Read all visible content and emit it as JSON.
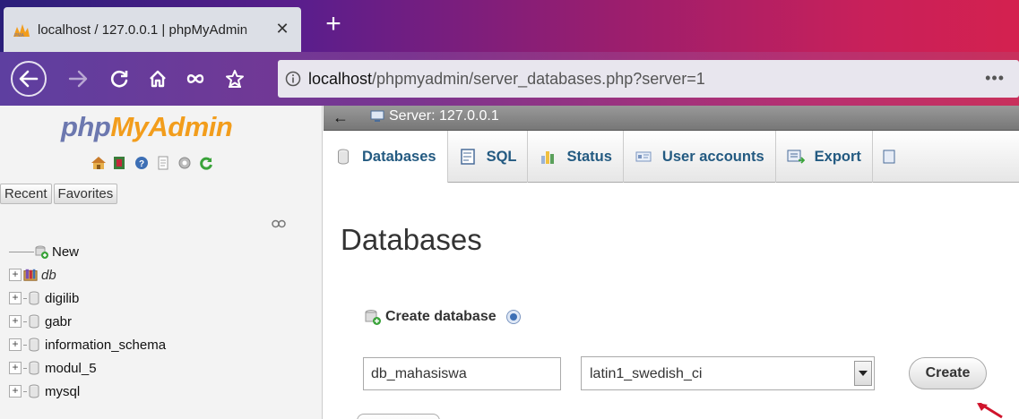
{
  "browser": {
    "tab_title": "localhost / 127.0.0.1 | phpMyAdmin",
    "tab_close": "✕",
    "new_tab": "+",
    "url_host": "localhost",
    "url_path": "/phpmyadmin/server_databases.php?server=1",
    "more": "•••"
  },
  "sidebar": {
    "logo_php": "php",
    "logo_myadmin": "MyAdmin",
    "recent_label": "Recent",
    "favorites_label": "Favorites",
    "tree": [
      {
        "label": "New",
        "italic": false
      },
      {
        "label": "db",
        "italic": true
      },
      {
        "label": "digilib",
        "italic": false
      },
      {
        "label": "gabr",
        "italic": false
      },
      {
        "label": "information_schema",
        "italic": false
      },
      {
        "label": "modul_5",
        "italic": false
      },
      {
        "label": "mysql",
        "italic": false
      }
    ]
  },
  "server_bar": {
    "label": "Server: 127.0.0.1"
  },
  "top_menu": [
    {
      "label": "Databases",
      "icon": "database-icon"
    },
    {
      "label": "SQL",
      "icon": "sql-icon"
    },
    {
      "label": "Status",
      "icon": "status-icon"
    },
    {
      "label": "User accounts",
      "icon": "user-accounts-icon"
    },
    {
      "label": "Export",
      "icon": "export-icon"
    }
  ],
  "main": {
    "title": "Databases",
    "create_heading": "Create database",
    "db_name_value": "db_mahasiswa",
    "collation_value": "latin1_swedish_ci",
    "create_button": "Create"
  },
  "colors": {
    "logo_php": "#6c78af",
    "logo_myadmin": "#f29d1c",
    "menu_link": "#235a81",
    "annotation_arrow": "#d0142c"
  }
}
